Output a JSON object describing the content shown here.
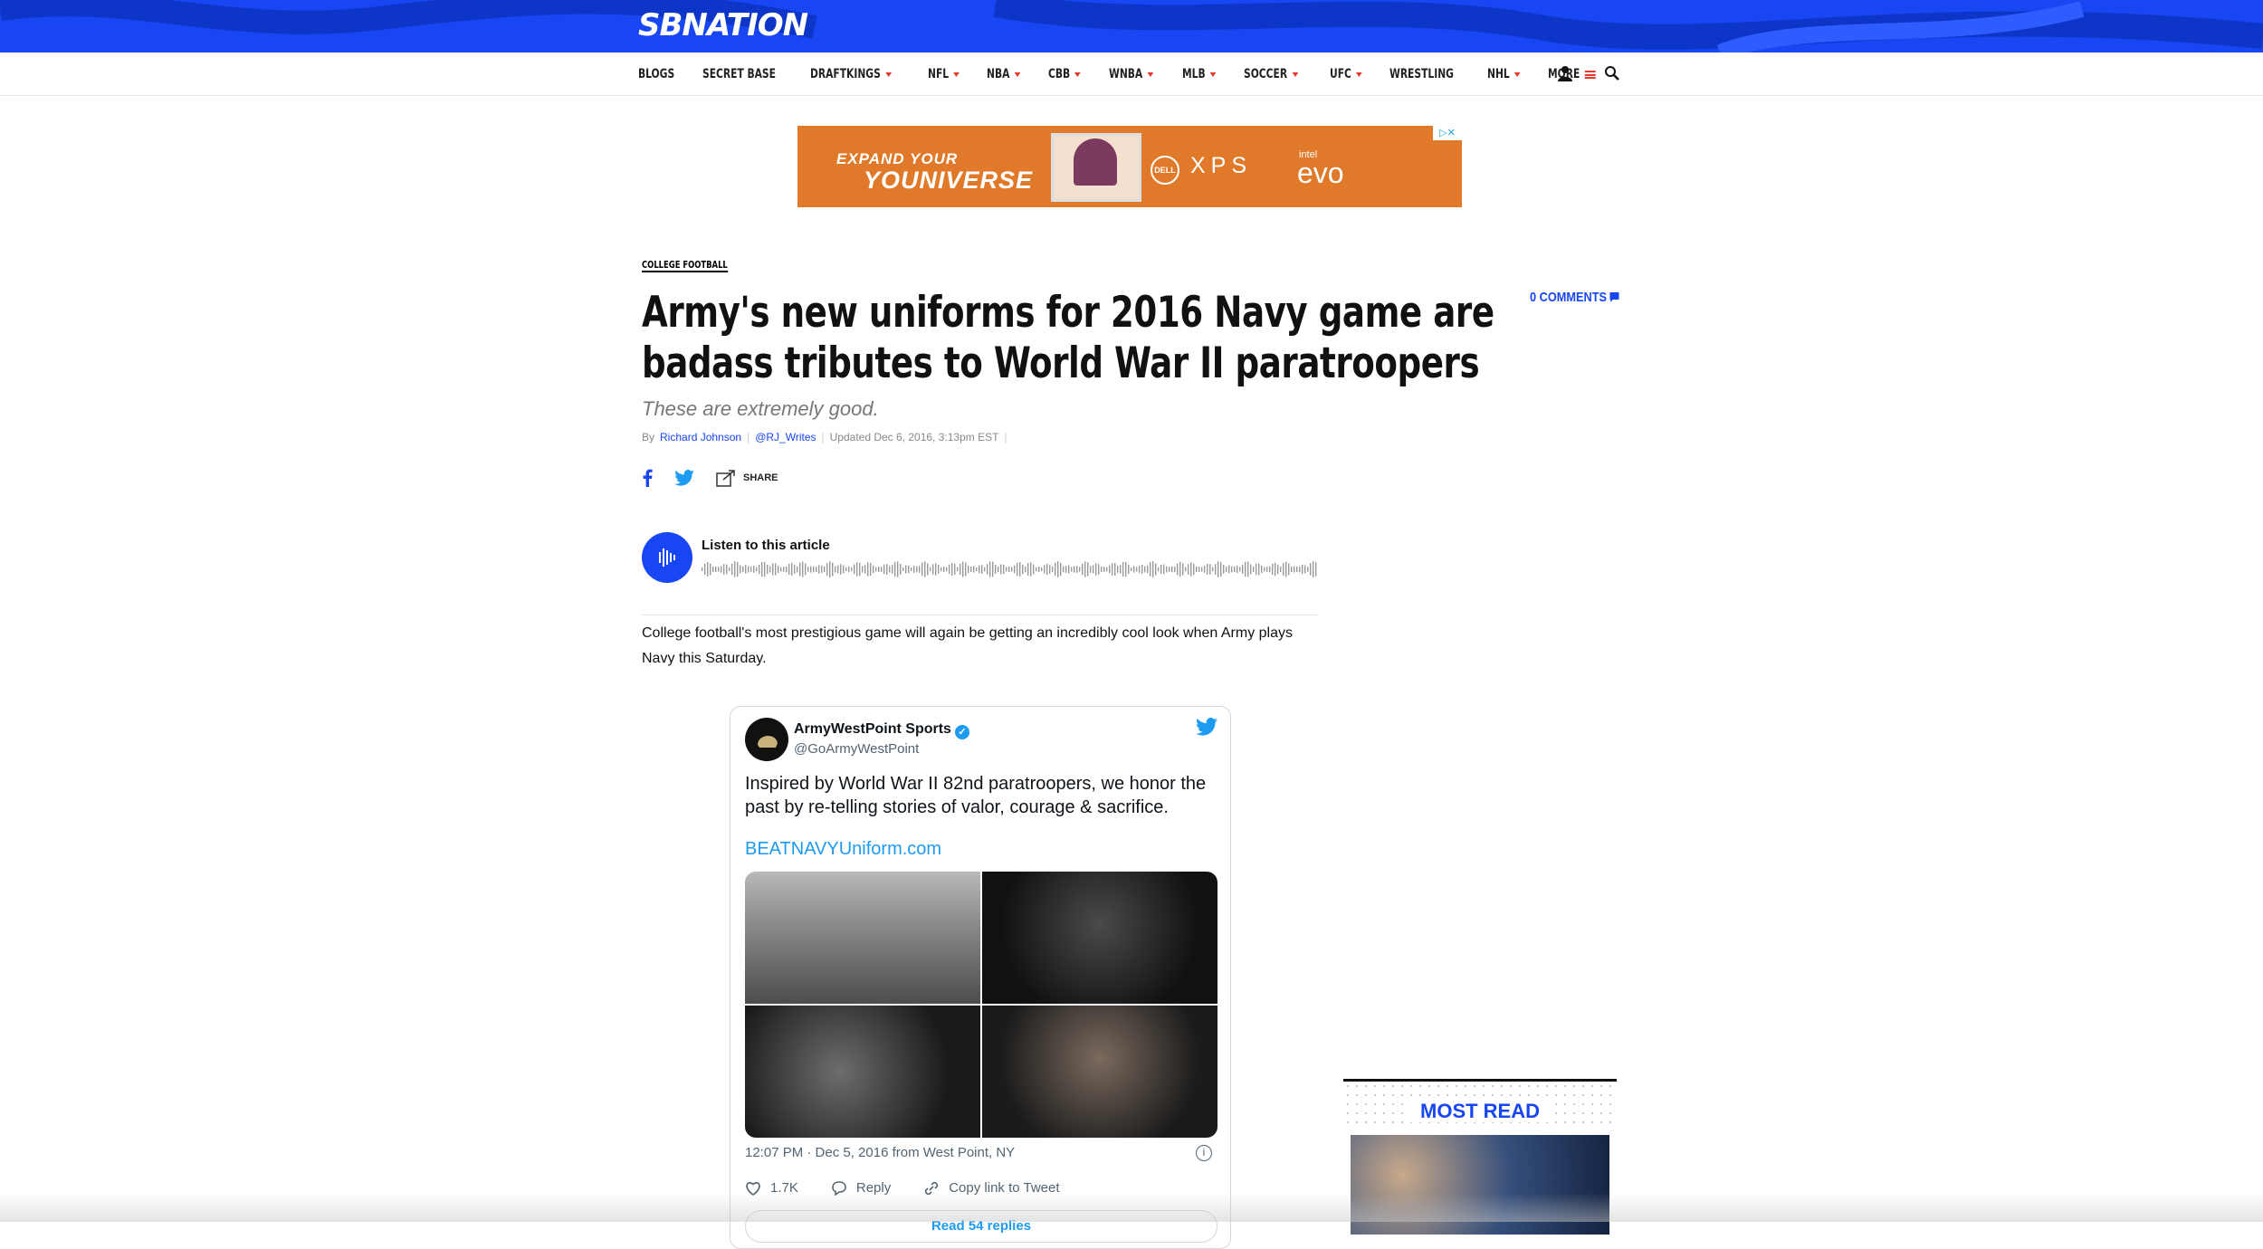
{
  "site": {
    "logo": "SBNATION"
  },
  "nav": {
    "items": [
      {
        "label": "BLOGS",
        "dropdown": false
      },
      {
        "label": "SECRET BASE",
        "dropdown": false
      },
      {
        "label": "DRAFTKINGS",
        "dropdown": true
      },
      {
        "label": "NFL",
        "dropdown": true
      },
      {
        "label": "NBA",
        "dropdown": true
      },
      {
        "label": "CBB",
        "dropdown": true
      },
      {
        "label": "WNBA",
        "dropdown": true
      },
      {
        "label": "MLB",
        "dropdown": true
      },
      {
        "label": "SOCCER",
        "dropdown": true
      },
      {
        "label": "UFC",
        "dropdown": true
      },
      {
        "label": "WRESTLING",
        "dropdown": false
      },
      {
        "label": "NHL",
        "dropdown": true
      }
    ],
    "more_label": "MORE",
    "user_icon": "user-icon",
    "search_icon": "search-icon"
  },
  "ad": {
    "line1": "EXPAND YOUR",
    "line2": "YOUNIVERSE",
    "dell": "DELL",
    "xps": "XPS",
    "intel": "intel",
    "evo": "evo",
    "choices": "▷✕"
  },
  "article": {
    "category": "COLLEGE FOOTBALL",
    "comments": "0 COMMENTS",
    "title": "Army's new uniforms for 2016 Navy game are badass tributes to World War II paratroopers",
    "dek": "These are extremely good.",
    "by": "By",
    "author": "Richard Johnson",
    "twitter_handle": "@RJ_Writes",
    "updated": "Updated Dec 6, 2016, 3:13pm EST",
    "share_label": "SHARE",
    "listen_label": "Listen to this article",
    "body": "College football's most prestigious game will again be getting an incredibly cool look when Army plays Navy this Saturday."
  },
  "tweet": {
    "name": "ArmyWestPoint Sports",
    "handle": "@GoArmyWestPoint",
    "text": "Inspired by World War II 82nd paratroopers, we honor the past by re-telling stories of valor, courage & sacrifice.",
    "link": "BEATNAVYUniform.com",
    "timestamp": "12:07 PM · Dec 5, 2016 from West Point, NY",
    "likes": "1.7K",
    "reply_label": "Reply",
    "copy_label": "Copy link to Tweet",
    "replies_label": "Read 54 replies"
  },
  "sidebar": {
    "most_read": "MOST READ"
  },
  "colors": {
    "brand": "#1746f2",
    "accent": "#e5372e",
    "twitter": "#1d9bf0"
  }
}
